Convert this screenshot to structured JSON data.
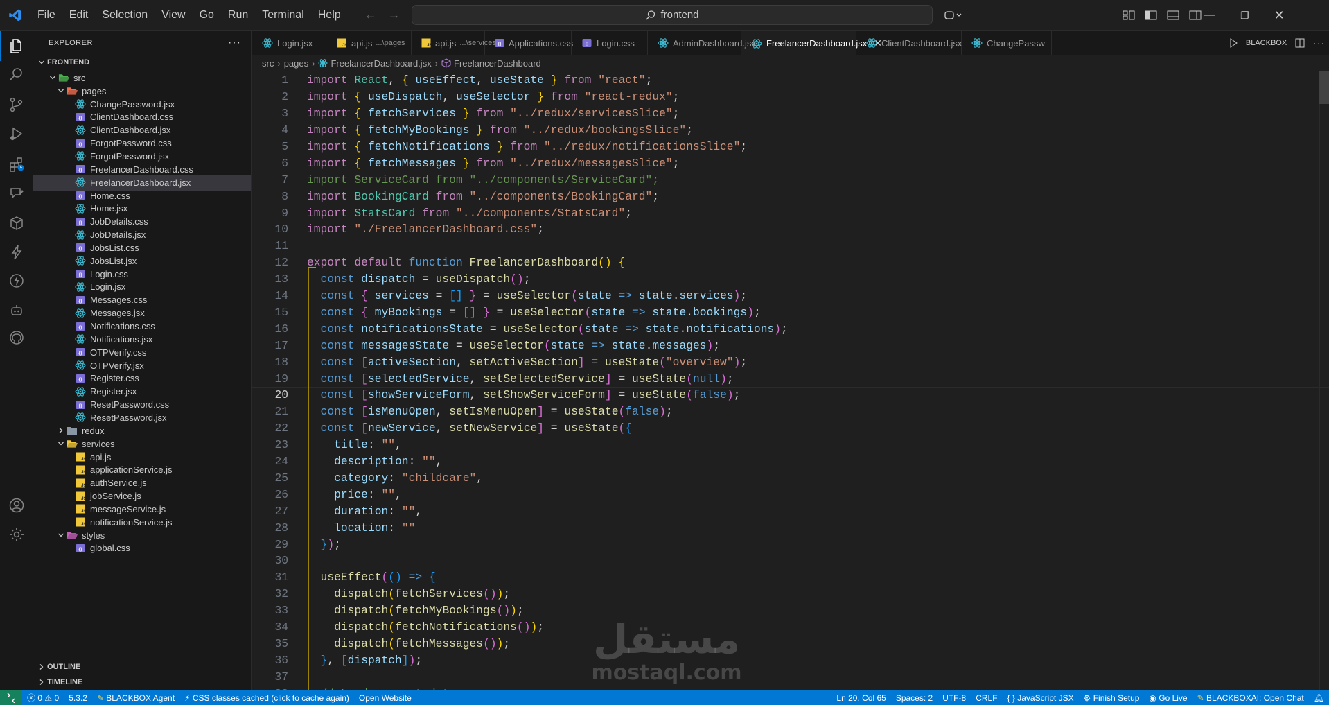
{
  "title_bar": {
    "menu": [
      "File",
      "Edit",
      "Selection",
      "View",
      "Go",
      "Run",
      "Terminal",
      "Help"
    ],
    "search_text": "frontend"
  },
  "activity_bar": [
    "explorer-icon",
    "search-icon",
    "source-control-icon",
    "run-debug-icon",
    "extensions-icon",
    "blackbox-icon",
    "remote-explorer-icon",
    "bolt-icon",
    "lightning-icon",
    "agent-icon",
    "github-icon",
    "accounts-icon",
    "settings-icon"
  ],
  "sidebar": {
    "header": "EXPLORER",
    "root": "FRONTEND",
    "tree": [
      {
        "label": "src",
        "type": "folder-open",
        "depth": 1,
        "icon": "src"
      },
      {
        "label": "pages",
        "type": "folder-open",
        "depth": 2,
        "icon": "pages"
      },
      {
        "label": "ChangePassword.jsx",
        "type": "jsx",
        "depth": 3
      },
      {
        "label": "ClientDashboard.css",
        "type": "css",
        "depth": 3
      },
      {
        "label": "ClientDashboard.jsx",
        "type": "jsx",
        "depth": 3
      },
      {
        "label": "ForgotPassword.css",
        "type": "css",
        "depth": 3
      },
      {
        "label": "ForgotPassword.jsx",
        "type": "jsx",
        "depth": 3
      },
      {
        "label": "FreelancerDashboard.css",
        "type": "css",
        "depth": 3
      },
      {
        "label": "FreelancerDashboard.jsx",
        "type": "jsx",
        "depth": 3,
        "selected": true
      },
      {
        "label": "Home.css",
        "type": "css",
        "depth": 3
      },
      {
        "label": "Home.jsx",
        "type": "jsx",
        "depth": 3
      },
      {
        "label": "JobDetails.css",
        "type": "css",
        "depth": 3
      },
      {
        "label": "JobDetails.jsx",
        "type": "jsx",
        "depth": 3
      },
      {
        "label": "JobsList.css",
        "type": "css",
        "depth": 3
      },
      {
        "label": "JobsList.jsx",
        "type": "jsx",
        "depth": 3
      },
      {
        "label": "Login.css",
        "type": "css",
        "depth": 3
      },
      {
        "label": "Login.jsx",
        "type": "jsx",
        "depth": 3
      },
      {
        "label": "Messages.css",
        "type": "css",
        "depth": 3
      },
      {
        "label": "Messages.jsx",
        "type": "jsx",
        "depth": 3
      },
      {
        "label": "Notifications.css",
        "type": "css",
        "depth": 3
      },
      {
        "label": "Notifications.jsx",
        "type": "jsx",
        "depth": 3
      },
      {
        "label": "OTPVerify.css",
        "type": "css",
        "depth": 3
      },
      {
        "label": "OTPVerify.jsx",
        "type": "jsx",
        "depth": 3
      },
      {
        "label": "Register.css",
        "type": "css",
        "depth": 3
      },
      {
        "label": "Register.jsx",
        "type": "jsx",
        "depth": 3
      },
      {
        "label": "ResetPassword.css",
        "type": "css",
        "depth": 3
      },
      {
        "label": "ResetPassword.jsx",
        "type": "jsx",
        "depth": 3
      },
      {
        "label": "redux",
        "type": "folder-closed",
        "depth": 2
      },
      {
        "label": "services",
        "type": "folder-open",
        "depth": 2,
        "icon": "services"
      },
      {
        "label": "api.js",
        "type": "js",
        "depth": 3
      },
      {
        "label": "applicationService.js",
        "type": "js",
        "depth": 3
      },
      {
        "label": "authService.js",
        "type": "js",
        "depth": 3
      },
      {
        "label": "jobService.js",
        "type": "js",
        "depth": 3
      },
      {
        "label": "messageService.js",
        "type": "js",
        "depth": 3
      },
      {
        "label": "notificationService.js",
        "type": "js",
        "depth": 3
      },
      {
        "label": "styles",
        "type": "folder-open",
        "depth": 2,
        "icon": "styles"
      },
      {
        "label": "global.css",
        "type": "css",
        "depth": 3
      }
    ],
    "sections": [
      "OUTLINE",
      "TIMELINE"
    ]
  },
  "tabs": [
    {
      "label": "Login.jsx",
      "type": "jsx",
      "sub": ""
    },
    {
      "label": "api.js",
      "type": "js",
      "sub": "...\\pages"
    },
    {
      "label": "api.js",
      "type": "js",
      "sub": "...\\services"
    },
    {
      "label": "Applications.css",
      "type": "css",
      "sub": ""
    },
    {
      "label": "Login.css",
      "type": "css",
      "sub": ""
    },
    {
      "label": "AdminDashboard.jsx",
      "type": "jsx",
      "sub": ""
    },
    {
      "label": "FreelancerDashboard.jsx",
      "type": "jsx",
      "sub": "",
      "active": true
    },
    {
      "label": "ClientDashboard.jsx",
      "type": "jsx",
      "sub": ""
    },
    {
      "label": "ChangePassw",
      "type": "jsx",
      "sub": ""
    }
  ],
  "tab_actions": {
    "blackbox_label": "BLACKBOX"
  },
  "breadcrumb": [
    "src",
    "pages",
    "FreelancerDashboard.jsx",
    "FreelancerDashboard"
  ],
  "code_lines": [
    [
      [
        "k",
        "import "
      ],
      [
        "t",
        "React"
      ],
      [
        "w",
        ", "
      ],
      [
        "p",
        "{ "
      ],
      [
        "v",
        "useEffect"
      ],
      [
        "w",
        ", "
      ],
      [
        "v",
        "useState"
      ],
      [
        "p",
        " }"
      ],
      [
        "k",
        " from "
      ],
      [
        "s",
        "\"react\""
      ],
      [
        "w",
        ";"
      ]
    ],
    [
      [
        "k",
        "import "
      ],
      [
        "p",
        "{ "
      ],
      [
        "v",
        "useDispatch"
      ],
      [
        "w",
        ", "
      ],
      [
        "v",
        "useSelector"
      ],
      [
        "p",
        " }"
      ],
      [
        "k",
        " from "
      ],
      [
        "s",
        "\"react-redux\""
      ],
      [
        "w",
        ";"
      ]
    ],
    [
      [
        "k",
        "import "
      ],
      [
        "p",
        "{ "
      ],
      [
        "v",
        "fetchServices"
      ],
      [
        "p",
        " }"
      ],
      [
        "k",
        " from "
      ],
      [
        "s",
        "\"../redux/servicesSlice\""
      ],
      [
        "w",
        ";"
      ]
    ],
    [
      [
        "k",
        "import "
      ],
      [
        "p",
        "{ "
      ],
      [
        "v",
        "fetchMyBookings"
      ],
      [
        "p",
        " }"
      ],
      [
        "k",
        " from "
      ],
      [
        "s",
        "\"../redux/bookingsSlice\""
      ],
      [
        "w",
        ";"
      ]
    ],
    [
      [
        "k",
        "import "
      ],
      [
        "p",
        "{ "
      ],
      [
        "v",
        "fetchNotifications"
      ],
      [
        "p",
        " }"
      ],
      [
        "k",
        " from "
      ],
      [
        "s",
        "\"../redux/notificationsSlice\""
      ],
      [
        "w",
        ";"
      ]
    ],
    [
      [
        "k",
        "import "
      ],
      [
        "p",
        "{ "
      ],
      [
        "v",
        "fetchMessages"
      ],
      [
        "p",
        " }"
      ],
      [
        "k",
        " from "
      ],
      [
        "s",
        "\"../redux/messagesSlice\""
      ],
      [
        "w",
        ";"
      ]
    ],
    [
      [
        "c",
        "import ServiceCard from \"../components/ServiceCard\";"
      ]
    ],
    [
      [
        "k",
        "import "
      ],
      [
        "t",
        "BookingCard"
      ],
      [
        "k",
        " from "
      ],
      [
        "s",
        "\"../components/BookingCard\""
      ],
      [
        "w",
        ";"
      ]
    ],
    [
      [
        "k",
        "import "
      ],
      [
        "t",
        "StatsCard"
      ],
      [
        "k",
        " from "
      ],
      [
        "s",
        "\"../components/StatsCard\""
      ],
      [
        "w",
        ";"
      ]
    ],
    [
      [
        "k",
        "import "
      ],
      [
        "s",
        "\"./FreelancerDashboard.css\""
      ],
      [
        "w",
        ";"
      ]
    ],
    [],
    [
      [
        "k",
        "export "
      ],
      [
        "k",
        "default "
      ],
      [
        "kb",
        "function "
      ],
      [
        "f",
        "FreelancerDashboard"
      ],
      [
        "p",
        "() {"
      ]
    ],
    [
      [
        "w",
        "  "
      ],
      [
        "kb",
        "const "
      ],
      [
        "v",
        "dispatch"
      ],
      [
        "w",
        " = "
      ],
      [
        "f",
        "useDispatch"
      ],
      [
        "p2",
        "()"
      ],
      [
        "w",
        ";"
      ]
    ],
    [
      [
        "w",
        "  "
      ],
      [
        "kb",
        "const "
      ],
      [
        "p2",
        "{ "
      ],
      [
        "v",
        "services"
      ],
      [
        "w",
        " = "
      ],
      [
        "p3",
        "[]"
      ],
      [
        "p2",
        " }"
      ],
      [
        "w",
        " = "
      ],
      [
        "f",
        "useSelector"
      ],
      [
        "p2",
        "("
      ],
      [
        "v",
        "state"
      ],
      [
        "kb",
        " => "
      ],
      [
        "v",
        "state"
      ],
      [
        "w",
        "."
      ],
      [
        "v",
        "services"
      ],
      [
        "p2",
        ")"
      ],
      [
        "w",
        ";"
      ]
    ],
    [
      [
        "w",
        "  "
      ],
      [
        "kb",
        "const "
      ],
      [
        "p2",
        "{ "
      ],
      [
        "v",
        "myBookings"
      ],
      [
        "w",
        " = "
      ],
      [
        "p3",
        "[]"
      ],
      [
        "p2",
        " }"
      ],
      [
        "w",
        " = "
      ],
      [
        "f",
        "useSelector"
      ],
      [
        "p2",
        "("
      ],
      [
        "v",
        "state"
      ],
      [
        "kb",
        " => "
      ],
      [
        "v",
        "state"
      ],
      [
        "w",
        "."
      ],
      [
        "v",
        "bookings"
      ],
      [
        "p2",
        ")"
      ],
      [
        "w",
        ";"
      ]
    ],
    [
      [
        "w",
        "  "
      ],
      [
        "kb",
        "const "
      ],
      [
        "v",
        "notificationsState"
      ],
      [
        "w",
        " = "
      ],
      [
        "f",
        "useSelector"
      ],
      [
        "p2",
        "("
      ],
      [
        "v",
        "state"
      ],
      [
        "kb",
        " => "
      ],
      [
        "v",
        "state"
      ],
      [
        "w",
        "."
      ],
      [
        "v",
        "notifications"
      ],
      [
        "p2",
        ")"
      ],
      [
        "w",
        ";"
      ]
    ],
    [
      [
        "w",
        "  "
      ],
      [
        "kb",
        "const "
      ],
      [
        "v",
        "messagesState"
      ],
      [
        "w",
        " = "
      ],
      [
        "f",
        "useSelector"
      ],
      [
        "p2",
        "("
      ],
      [
        "v",
        "state"
      ],
      [
        "kb",
        " => "
      ],
      [
        "v",
        "state"
      ],
      [
        "w",
        "."
      ],
      [
        "v",
        "messages"
      ],
      [
        "p2",
        ")"
      ],
      [
        "w",
        ";"
      ]
    ],
    [
      [
        "w",
        "  "
      ],
      [
        "kb",
        "const "
      ],
      [
        "p2",
        "["
      ],
      [
        "v",
        "activeSection"
      ],
      [
        "w",
        ", "
      ],
      [
        "f",
        "setActiveSection"
      ],
      [
        "p2",
        "]"
      ],
      [
        "w",
        " = "
      ],
      [
        "f",
        "useState"
      ],
      [
        "p2",
        "("
      ],
      [
        "s",
        "\"overview\""
      ],
      [
        "p2",
        ")"
      ],
      [
        "w",
        ";"
      ]
    ],
    [
      [
        "w",
        "  "
      ],
      [
        "kb",
        "const "
      ],
      [
        "p2",
        "["
      ],
      [
        "v",
        "selectedService"
      ],
      [
        "w",
        ", "
      ],
      [
        "f",
        "setSelectedService"
      ],
      [
        "p2",
        "]"
      ],
      [
        "w",
        " = "
      ],
      [
        "f",
        "useState"
      ],
      [
        "p2",
        "("
      ],
      [
        "kb",
        "null"
      ],
      [
        "p2",
        ")"
      ],
      [
        "w",
        ";"
      ]
    ],
    [
      [
        "w",
        "  "
      ],
      [
        "kb",
        "const "
      ],
      [
        "p2",
        "["
      ],
      [
        "v",
        "showServiceForm"
      ],
      [
        "w",
        ", "
      ],
      [
        "f",
        "setShowServiceForm"
      ],
      [
        "p2",
        "]"
      ],
      [
        "w",
        " = "
      ],
      [
        "f",
        "useState"
      ],
      [
        "p2",
        "("
      ],
      [
        "kb",
        "false"
      ],
      [
        "p2",
        ")"
      ],
      [
        "w",
        ";"
      ]
    ],
    [
      [
        "w",
        "  "
      ],
      [
        "kb",
        "const "
      ],
      [
        "p2",
        "["
      ],
      [
        "v",
        "isMenuOpen"
      ],
      [
        "w",
        ", "
      ],
      [
        "f",
        "setIsMenuOpen"
      ],
      [
        "p2",
        "]"
      ],
      [
        "w",
        " = "
      ],
      [
        "f",
        "useState"
      ],
      [
        "p2",
        "("
      ],
      [
        "kb",
        "false"
      ],
      [
        "p2",
        ")"
      ],
      [
        "w",
        ";"
      ]
    ],
    [
      [
        "w",
        "  "
      ],
      [
        "kb",
        "const "
      ],
      [
        "p2",
        "["
      ],
      [
        "v",
        "newService"
      ],
      [
        "w",
        ", "
      ],
      [
        "f",
        "setNewService"
      ],
      [
        "p2",
        "]"
      ],
      [
        "w",
        " = "
      ],
      [
        "f",
        "useState"
      ],
      [
        "p2",
        "("
      ],
      [
        "p3",
        "{"
      ]
    ],
    [
      [
        "w",
        "    "
      ],
      [
        "v",
        "title"
      ],
      [
        "w",
        ": "
      ],
      [
        "s",
        "\"\""
      ],
      [
        "w",
        ","
      ]
    ],
    [
      [
        "w",
        "    "
      ],
      [
        "v",
        "description"
      ],
      [
        "w",
        ": "
      ],
      [
        "s",
        "\"\""
      ],
      [
        "w",
        ","
      ]
    ],
    [
      [
        "w",
        "    "
      ],
      [
        "v",
        "category"
      ],
      [
        "w",
        ": "
      ],
      [
        "s",
        "\"childcare\""
      ],
      [
        "w",
        ","
      ]
    ],
    [
      [
        "w",
        "    "
      ],
      [
        "v",
        "price"
      ],
      [
        "w",
        ": "
      ],
      [
        "s",
        "\"\""
      ],
      [
        "w",
        ","
      ]
    ],
    [
      [
        "w",
        "    "
      ],
      [
        "v",
        "duration"
      ],
      [
        "w",
        ": "
      ],
      [
        "s",
        "\"\""
      ],
      [
        "w",
        ","
      ]
    ],
    [
      [
        "w",
        "    "
      ],
      [
        "v",
        "location"
      ],
      [
        "w",
        ": "
      ],
      [
        "s",
        "\"\""
      ]
    ],
    [
      [
        "w",
        "  "
      ],
      [
        "p3",
        "}"
      ],
      [
        "p2",
        ")"
      ],
      [
        "w",
        ";"
      ]
    ],
    [],
    [
      [
        "w",
        "  "
      ],
      [
        "f",
        "useEffect"
      ],
      [
        "p2",
        "("
      ],
      [
        "p3",
        "()"
      ],
      [
        "kb",
        " => "
      ],
      [
        "p3",
        "{"
      ]
    ],
    [
      [
        "w",
        "    "
      ],
      [
        "f",
        "dispatch"
      ],
      [
        "p",
        "("
      ],
      [
        "f",
        "fetchServices"
      ],
      [
        "p2",
        "()"
      ],
      [
        "p",
        ")"
      ],
      [
        "w",
        ";"
      ]
    ],
    [
      [
        "w",
        "    "
      ],
      [
        "f",
        "dispatch"
      ],
      [
        "p",
        "("
      ],
      [
        "f",
        "fetchMyBookings"
      ],
      [
        "p2",
        "()"
      ],
      [
        "p",
        ")"
      ],
      [
        "w",
        ";"
      ]
    ],
    [
      [
        "w",
        "    "
      ],
      [
        "f",
        "dispatch"
      ],
      [
        "p",
        "("
      ],
      [
        "f",
        "fetchNotifications"
      ],
      [
        "p2",
        "()"
      ],
      [
        "p",
        ")"
      ],
      [
        "w",
        ";"
      ]
    ],
    [
      [
        "w",
        "    "
      ],
      [
        "f",
        "dispatch"
      ],
      [
        "p",
        "("
      ],
      [
        "f",
        "fetchMessages"
      ],
      [
        "p2",
        "()"
      ],
      [
        "p",
        ")"
      ],
      [
        "w",
        ";"
      ]
    ],
    [
      [
        "w",
        "  "
      ],
      [
        "p3",
        "}"
      ],
      [
        "w",
        ", "
      ],
      [
        "p3",
        "["
      ],
      [
        "v",
        "dispatch"
      ],
      [
        "p3",
        "]"
      ],
      [
        "p2",
        ")"
      ],
      [
        "w",
        ";"
      ]
    ],
    [],
    [
      [
        "c",
        "  // Load current data"
      ]
    ]
  ],
  "cursor_line": 20,
  "status": {
    "errors": "0",
    "warnings": "0",
    "version": "5.3.2",
    "blackbox_agent": "BLACKBOX Agent",
    "css_cache": "CSS classes cached (click to cache again)",
    "open_website": "Open Website",
    "position": "Ln 20, Col 65",
    "spaces": "Spaces: 2",
    "encoding": "UTF-8",
    "eol": "CRLF",
    "language": "JavaScript JSX",
    "finish_setup": "Finish Setup",
    "go_live": "Go Live",
    "blackbox_chat": "BLACKBOXAI: Open Chat"
  },
  "watermark": {
    "arabic": "مستقل",
    "latin": "mostaql.com"
  },
  "colors": {
    "accent": "#0078d4",
    "jsx": "#3ec0d8",
    "css": "#7b6fd6",
    "js": "#f0c83a"
  }
}
